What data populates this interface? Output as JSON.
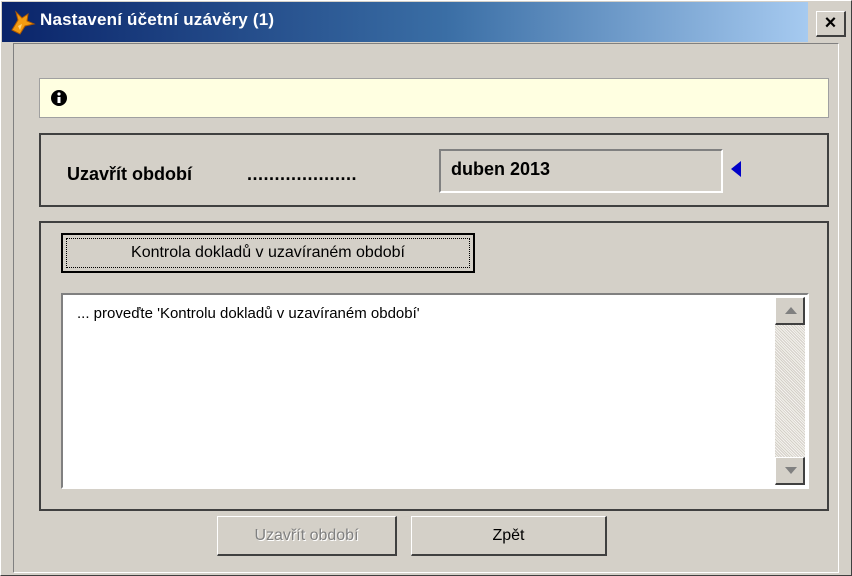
{
  "window": {
    "title": "Nastavení účetní uzávěry (1)",
    "close_symbol": "×"
  },
  "info": {
    "icon": "info-icon",
    "message": ""
  },
  "period": {
    "label": "Uzavřít období",
    "dots": "....................",
    "value": "duben 2013",
    "arrow_icon": "left-arrow-icon"
  },
  "check": {
    "button_label": "Kontrola dokladů v uzavíraném období",
    "log_text": "... proveďte 'Kontrolu dokladů v uzavíraném období'"
  },
  "footer": {
    "close_period_label": "Uzavřít období",
    "back_label": "Zpět"
  },
  "colors": {
    "title_gradient_start": "#0a246a",
    "title_gradient_end": "#a6caf0",
    "info_background": "#ffffe1",
    "arrow": "#0000c8",
    "face": "#d4d0c8"
  }
}
